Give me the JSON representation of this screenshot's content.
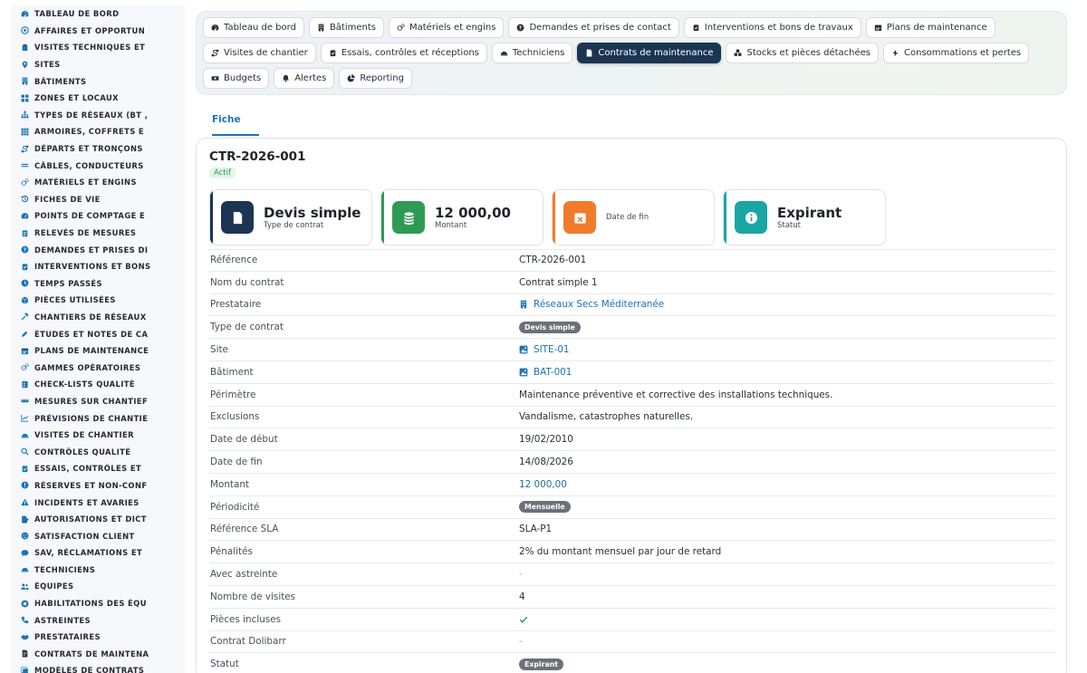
{
  "colors": {
    "primary": "#1a73b8",
    "navy": "#1c3552",
    "green": "#2e9b55",
    "orange": "#f07b2c",
    "teal": "#1aa6a6"
  },
  "sidebar": {
    "items": [
      {
        "label": "TABLEAU DE BORD",
        "icon": "dashboard-icon"
      },
      {
        "label": "AFFAIRES ET OPPORTUN",
        "icon": "target-icon"
      },
      {
        "label": "VISITES TECHNIQUES ET",
        "icon": "clipboard-icon"
      },
      {
        "label": "SITES",
        "icon": "map-pin-icon"
      },
      {
        "label": "BÂTIMENTS",
        "icon": "building-icon"
      },
      {
        "label": "ZONES ET LOCAUX",
        "icon": "grid-icon"
      },
      {
        "label": "TYPES DE RÉSEAUX (BT ,",
        "icon": "network-icon"
      },
      {
        "label": "ARMOIRES, COFFRETS E",
        "icon": "th-icon"
      },
      {
        "label": "DÉPARTS ET TRONÇONS",
        "icon": "route-icon"
      },
      {
        "label": "CÂBLES, CONDUCTEURS",
        "icon": "lines-icon"
      },
      {
        "label": "MATÉRIELS ET ENGINS",
        "icon": "cogs-icon"
      },
      {
        "label": "FICHES DE VIE",
        "icon": "history-icon"
      },
      {
        "label": "POINTS DE COMPTAGE E",
        "icon": "tachometer-icon"
      },
      {
        "label": "RELEVÉS DE MESURES",
        "icon": "clipboard-list-icon"
      },
      {
        "label": "DEMANDES ET PRISES DI",
        "icon": "question-icon"
      },
      {
        "label": "INTERVENTIONS ET BONS",
        "icon": "clipboard-check-icon"
      },
      {
        "label": "TEMPS PASSÉS",
        "icon": "clock-icon"
      },
      {
        "label": "PIÈCES UTILISÉES",
        "icon": "cube-icon"
      },
      {
        "label": "CHANTIERS DE RÉSEAUX",
        "icon": "hammer-icon"
      },
      {
        "label": "ÉTUDES ET NOTES DE CA",
        "icon": "pen-ruler-icon"
      },
      {
        "label": "PLANS DE MAINTENANCE",
        "icon": "calendar-icon"
      },
      {
        "label": "GAMMES OPÉRATOIRES",
        "icon": "cogs-icon"
      },
      {
        "label": "CHECK-LISTS QUALITÉ",
        "icon": "checklist-icon"
      },
      {
        "label": "MESURES SUR CHANTIEF",
        "icon": "ruler-icon"
      },
      {
        "label": "PRÉVISIONS DE CHANTIE",
        "icon": "chart-line-icon"
      },
      {
        "label": "VISITES DE CHANTIER",
        "icon": "helmet-icon"
      },
      {
        "label": "CONTRÔLES QUALITÉ",
        "icon": "search-icon"
      },
      {
        "label": "ESSAIS, CONTRÔLES ET",
        "icon": "clipboard-check-icon"
      },
      {
        "label": "RÉSERVES ET NON-CONF",
        "icon": "exclamation-circle-icon"
      },
      {
        "label": "INCIDENTS ET AVARIES",
        "icon": "warning-icon"
      },
      {
        "label": "AUTORISATIONS ET DICT",
        "icon": "file-signature-icon"
      },
      {
        "label": "SATISFACTION CLIENT",
        "icon": "smile-icon"
      },
      {
        "label": "SAV, RÉCLAMATIONS ET",
        "icon": "comment-icon"
      },
      {
        "label": "TECHNICIENS",
        "icon": "helmet-icon"
      },
      {
        "label": "ÉQUIPES",
        "icon": "users-icon"
      },
      {
        "label": "HABILITATIONS DES ÉQU",
        "icon": "certificate-icon"
      },
      {
        "label": "ASTREINTES",
        "icon": "phone-icon"
      },
      {
        "label": "PRESTATAIRES",
        "icon": "handshake-icon"
      },
      {
        "label": "CONTRATS DE MAINTENA",
        "icon": "file-contract-icon"
      },
      {
        "label": "MODÈLES DE CONTRATS",
        "icon": "copy-icon"
      }
    ]
  },
  "tabs": [
    {
      "label": "Tableau de bord",
      "icon": "dashboard-icon",
      "active": false
    },
    {
      "label": "Bâtiments",
      "icon": "building-icon",
      "active": false
    },
    {
      "label": "Matériels et engins",
      "icon": "cogs-icon",
      "active": false
    },
    {
      "label": "Demandes et prises de contact",
      "icon": "question-icon",
      "active": false
    },
    {
      "label": "Interventions et bons de travaux",
      "icon": "clipboard-check-icon",
      "active": false
    },
    {
      "label": "Plans de maintenance",
      "icon": "calendar-icon",
      "active": false
    },
    {
      "label": "Visites de chantier",
      "icon": "route-icon",
      "active": false
    },
    {
      "label": "Essais, contrôles et réceptions",
      "icon": "clipboard-check-icon",
      "active": false
    },
    {
      "label": "Techniciens",
      "icon": "helmet-icon",
      "active": false
    },
    {
      "label": "Contrats de maintenance",
      "icon": "file-contract-icon",
      "active": true
    },
    {
      "label": "Stocks et pièces détachées",
      "icon": "boxes-icon",
      "active": false
    },
    {
      "label": "Consommations et pertes",
      "icon": "bolt-icon",
      "active": false
    },
    {
      "label": "Budgets",
      "icon": "money-icon",
      "active": false
    },
    {
      "label": "Alertes",
      "icon": "bell-icon",
      "active": false
    },
    {
      "label": "Reporting",
      "icon": "chart-pie-icon",
      "active": false
    }
  ],
  "subtab": {
    "label": "Fiche"
  },
  "record": {
    "reference": "CTR-2026-001",
    "status_badge": "Actif"
  },
  "kpis": [
    {
      "value": "Devis simple",
      "label": "Type de contrat",
      "color": "#1c3552",
      "icon": "file-contract-icon"
    },
    {
      "value": "12 000,00",
      "label": "Montant",
      "color": "#2e9b55",
      "icon": "coins-icon"
    },
    {
      "value": "",
      "label": "Date de fin",
      "color": "#f07b2c",
      "icon": "calendar-times-icon"
    },
    {
      "value": "Expirant",
      "label": "Statut",
      "color": "#1aa6a6",
      "icon": "info-icon"
    }
  ],
  "fields": [
    {
      "key": "Référence",
      "value": "CTR-2026-001",
      "kind": "text"
    },
    {
      "key": "Nom du contrat",
      "value": "Contrat simple 1",
      "kind": "text"
    },
    {
      "key": "Prestataire",
      "value": "Réseaux Secs Méditerranée",
      "kind": "link",
      "icon": "building-icon"
    },
    {
      "key": "Type de contrat",
      "value": "Devis simple",
      "kind": "pill"
    },
    {
      "key": "Site",
      "value": "SITE-01",
      "kind": "link",
      "icon": "site-icon"
    },
    {
      "key": "Bâtiment",
      "value": "BAT-001",
      "kind": "link",
      "icon": "site-icon"
    },
    {
      "key": "Périmètre",
      "value": "Maintenance préventive et corrective des installations techniques.",
      "kind": "text"
    },
    {
      "key": "Exclusions",
      "value": "Vandalisme, catastrophes naturelles.",
      "kind": "text"
    },
    {
      "key": "Date de début",
      "value": "19/02/2010",
      "kind": "text"
    },
    {
      "key": "Date de fin",
      "value": "14/08/2026",
      "kind": "text"
    },
    {
      "key": "Montant",
      "value": "12 000,00",
      "kind": "money"
    },
    {
      "key": "Périodicité",
      "value": "Mensuelle",
      "kind": "pill"
    },
    {
      "key": "Référence SLA",
      "value": "SLA-P1",
      "kind": "text"
    },
    {
      "key": "Pénalités",
      "value": "2% du montant mensuel par jour de retard",
      "kind": "text"
    },
    {
      "key": "Avec astreinte",
      "value": "-",
      "kind": "dash"
    },
    {
      "key": "Nombre de visites",
      "value": "4",
      "kind": "text"
    },
    {
      "key": "Pièces incluses",
      "value": "",
      "kind": "check"
    },
    {
      "key": "Contrat Dolibarr",
      "value": "-",
      "kind": "dash"
    },
    {
      "key": "Statut",
      "value": "Expirant",
      "kind": "pill"
    }
  ]
}
